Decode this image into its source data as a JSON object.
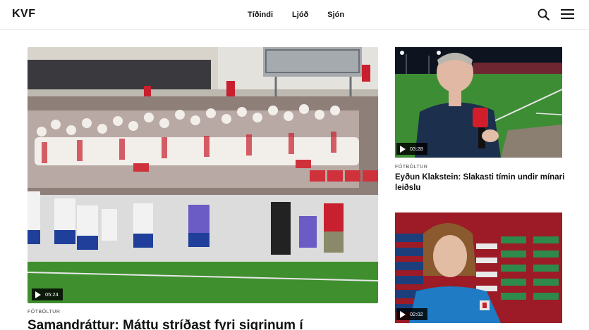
{
  "header": {
    "logo": "KVF",
    "nav": [
      "Tíðindi",
      "Ljóð",
      "Sjón"
    ]
  },
  "main_article": {
    "duration": "05:24",
    "category": "FÓTBÓLTUR",
    "title": "Samandráttur: Máttu stríðast fyri sigrinum í"
  },
  "side_articles": [
    {
      "duration": "03:28",
      "category": "FÓTBÓLTUR",
      "title": "Eyðun Klakstein: Slakasti tímin undir mínari leiðslu"
    },
    {
      "duration": "02:02"
    }
  ],
  "icons": {
    "search": "search-icon",
    "menu": "hamburger-menu-icon",
    "play": "play-icon"
  },
  "colors": {
    "pitch_green": "#3f8f2e",
    "jersey_red": "#c8202e",
    "interview_red": "#9c1b26"
  }
}
